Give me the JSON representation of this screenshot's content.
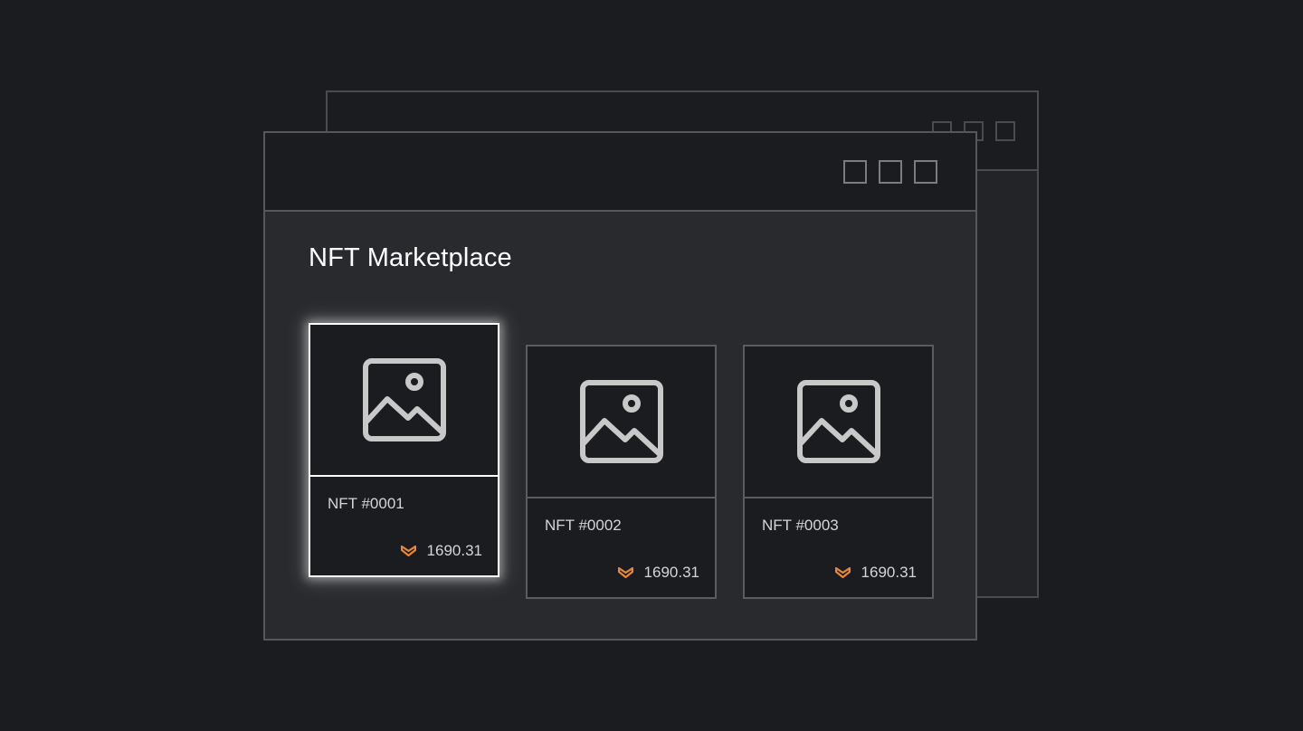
{
  "app": {
    "title": "NFT Marketplace"
  },
  "colors": {
    "background": "#1b1c1f",
    "window_body": "#282a2d",
    "card_border": "#5a5c60",
    "selected_border": "#ffffff",
    "token_accent": "#e8873a"
  },
  "nfts": [
    {
      "name": "NFT #0001",
      "price": "1690.31",
      "icon": "image-placeholder-icon",
      "currency_icon": "token-logo-icon",
      "selected": true
    },
    {
      "name": "NFT #0002",
      "price": "1690.31",
      "icon": "image-placeholder-icon",
      "currency_icon": "token-logo-icon",
      "selected": false
    },
    {
      "name": "NFT #0003",
      "price": "1690.31",
      "icon": "image-placeholder-icon",
      "currency_icon": "token-logo-icon",
      "selected": false
    }
  ]
}
